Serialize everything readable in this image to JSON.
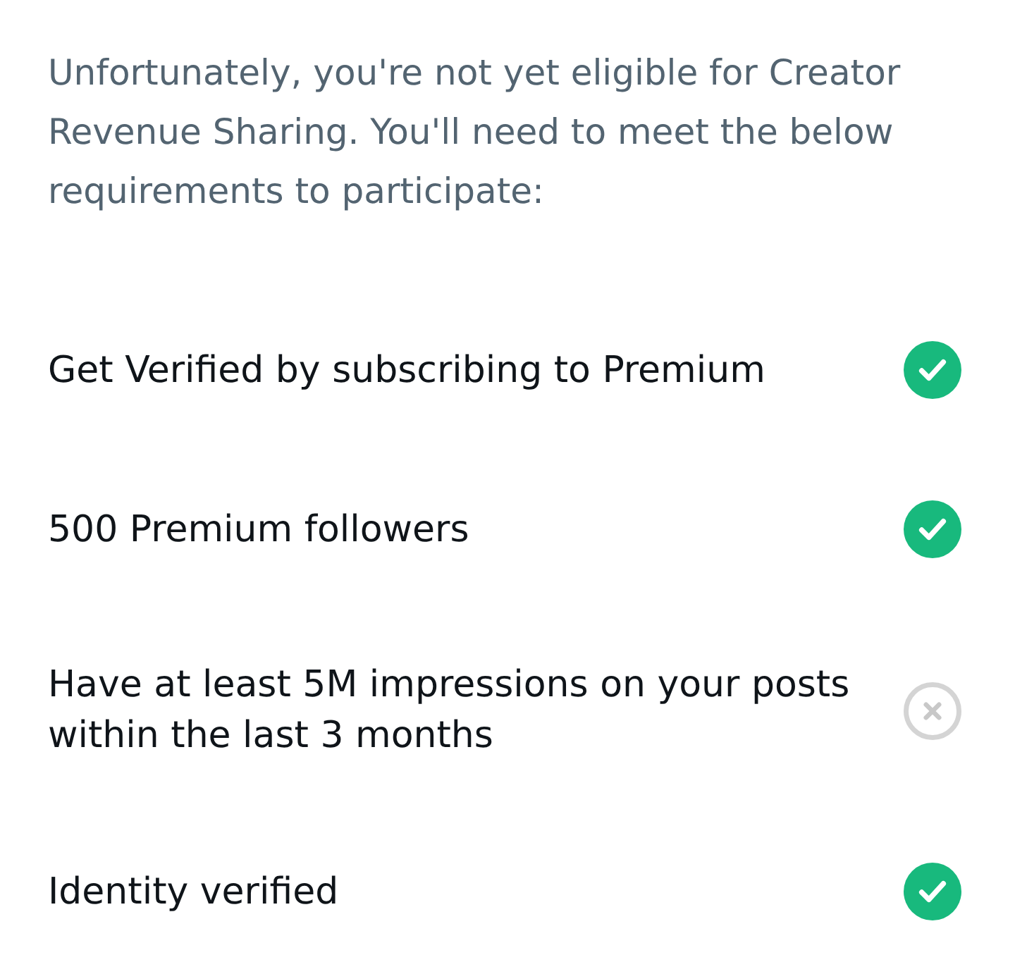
{
  "intro": "Unfortunately, you're not yet eligible for Creator Revenue Sharing. You'll need to meet the below requirements to participate:",
  "requirements": [
    {
      "label": "Get Verified by subscribing to Premium",
      "met": true
    },
    {
      "label": "500 Premium followers",
      "met": true
    },
    {
      "label": "Have at least 5M impressions on your posts within the last 3 months",
      "met": false
    },
    {
      "label": "Identity verified",
      "met": true
    }
  ]
}
